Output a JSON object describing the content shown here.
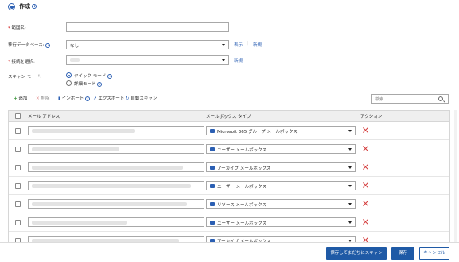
{
  "header": {
    "title": "作成",
    "info": "i"
  },
  "form": {
    "scope_label": "範囲名:",
    "scope_value": "",
    "target_db_label": "移行データベース:",
    "target_db_value": "なし",
    "show_link": "表示",
    "separator": "|",
    "new_link_1": "新規",
    "connection_label": "接続を選択:",
    "connection_value": "",
    "new_link_2": "新規",
    "scan_mode_label": "スキャン モード:",
    "quick_mode": "クイック モード",
    "detailed_mode": "詳細モード"
  },
  "toolbar": {
    "add": "追加",
    "delete": "削除",
    "import": "インポート",
    "export": "エクスポート",
    "autoscan": "自動スキャン",
    "search_placeholder": "検索"
  },
  "table": {
    "columns": [
      "メール アドレス",
      "メールボックス タイプ",
      "アクション"
    ],
    "rows": [
      {
        "type": "Microsoft 365 グループ メールボックス"
      },
      {
        "type": "ユーザー メールボックス"
      },
      {
        "type": "アーカイブ メールボックス"
      },
      {
        "type": "ユーザー メールボックス"
      },
      {
        "type": "リソース メールボックス"
      },
      {
        "type": "ユーザー メールボックス"
      },
      {
        "type": "アーカイブ メールボックス"
      }
    ]
  },
  "footer": {
    "save_scan": "保存してまだちにスキャン",
    "save": "保存",
    "cancel": "キャンセル"
  },
  "colors": {
    "accent": "#1f5aa6",
    "danger": "#d43a3a"
  }
}
